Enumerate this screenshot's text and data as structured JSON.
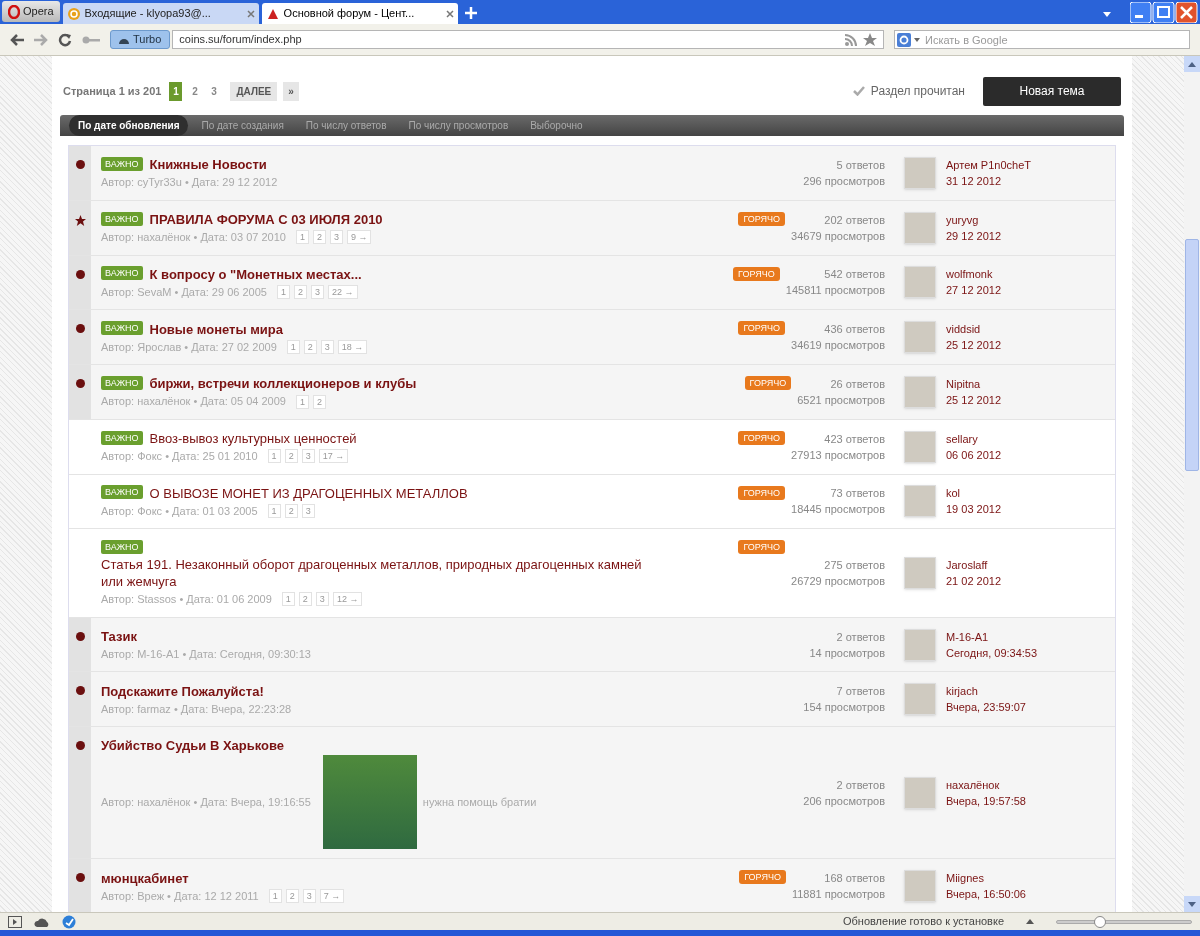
{
  "browser": {
    "menu_label": "Opera",
    "tabs": [
      {
        "title": "Входящие - klyopa93@...",
        "selected": false
      },
      {
        "title": "Основной форум - Цент...",
        "selected": true
      }
    ],
    "turbo": "Turbo",
    "address": "coins.su/forum/index.php",
    "search_placeholder": "Искать в Google"
  },
  "pagination": {
    "label": "Страница 1 из 201",
    "pages": [
      {
        "label": "1",
        "selected": true
      },
      {
        "label": "2",
        "selected": false
      },
      {
        "label": "3",
        "selected": false
      }
    ],
    "next": "ДАЛЕЕ",
    "last": "»"
  },
  "mark_read": "Раздел прочитан",
  "new_topic": "Новая тема",
  "sort_tabs": [
    {
      "label": "По дате обновления",
      "selected": true
    },
    {
      "label": "По дате создания",
      "selected": false
    },
    {
      "label": "По числу ответов",
      "selected": false
    },
    {
      "label": "По числу просмотров",
      "selected": false
    },
    {
      "label": "Выборочно",
      "selected": false
    }
  ],
  "topics": [
    {
      "unread": true,
      "starred": false,
      "badge": "ВАЖНО",
      "title": "Книжные Новости",
      "meta": "Автор: cyTyr33u • Дата: 29 12 2012",
      "replies": "5 ответов",
      "views": "296 просмотров",
      "last_user": "Артем P1n0cheT",
      "last_date": "31 12 2012"
    },
    {
      "unread": true,
      "starred": true,
      "badge": "ВАЖНО",
      "title": "ПРАВИЛА ФОРУМА С 03 ИЮЛЯ 2010",
      "meta": "Автор: нахалёнок • Дата: 03 07 2010",
      "pages": [
        "1",
        "2",
        "3",
        "9 →"
      ],
      "hot": "ГОРЯЧО",
      "replies": "202 ответов",
      "views": "34679 просмотров",
      "last_user": "yuryvg",
      "last_date": "29 12 2012"
    },
    {
      "unread": true,
      "starred": false,
      "badge": "ВАЖНО",
      "title": "К вопросу о \"Монетных местах...",
      "meta": "Автор: SevaM • Дата: 29 06 2005",
      "pages": [
        "1",
        "2",
        "3",
        "22 →"
      ],
      "hot": "ГОРЯЧО",
      "replies": "542 ответов",
      "views": "145811 просмотров",
      "last_user": "wolfmonk",
      "last_date": "27 12 2012"
    },
    {
      "unread": true,
      "starred": false,
      "badge": "ВАЖНО",
      "title": "Новые монеты мира",
      "meta": "Автор: Ярослав • Дата: 27 02 2009",
      "pages": [
        "1",
        "2",
        "3",
        "18 →"
      ],
      "hot": "ГОРЯЧО",
      "replies": "436 ответов",
      "views": "34619 просмотров",
      "last_user": "viddsid",
      "last_date": "25 12 2012"
    },
    {
      "unread": true,
      "starred": false,
      "badge": "ВАЖНО",
      "title": "биржи, встречи коллекционеров и клубы",
      "meta": "Автор: нахалёнок • Дата: 05 04 2009",
      "pages": [
        "1",
        "2"
      ],
      "hot": "ГОРЯЧО",
      "replies": "26 ответов",
      "views": "6521 просмотров",
      "last_user": "Nipitna",
      "last_date": "25 12 2012"
    },
    {
      "unread": false,
      "starred": false,
      "badge": "ВАЖНО",
      "title": "Ввоз-вывоз культурных ценностей",
      "meta": "Автор: Фокс • Дата: 25 01 2010",
      "pages": [
        "1",
        "2",
        "3",
        "17 →"
      ],
      "hot": "ГОРЯЧО",
      "replies": "423 ответов",
      "views": "27913 просмотров",
      "last_user": "sellary",
      "last_date": "06 06 2012"
    },
    {
      "unread": false,
      "starred": false,
      "badge": "ВАЖНО",
      "title": "О ВЫВОЗЕ МОНЕТ ИЗ ДРАГОЦЕННЫХ МЕТАЛЛОВ",
      "meta": "Автор: Фокс • Дата: 01 03 2005",
      "pages": [
        "1",
        "2",
        "3"
      ],
      "hot": "ГОРЯЧО",
      "replies": "73 ответов",
      "views": "18445 просмотров",
      "last_user": "kol",
      "last_date": "19 03 2012"
    },
    {
      "unread": false,
      "starred": false,
      "badge": "ВАЖНО",
      "title": "Статья 191. Незаконный оборот драгоценных металлов, природных драгоценных камней или жемчуга",
      "meta": "Автор: Stassos • Дата: 01 06 2009",
      "pages": [
        "1",
        "2",
        "3",
        "12 →"
      ],
      "hot": "ГОРЯЧО",
      "replies": "275 ответов",
      "views": "26729 просмотров",
      "last_user": "Jaroslaff",
      "last_date": "21 02 2012"
    },
    {
      "unread": true,
      "starred": false,
      "title": "Тазик",
      "meta": "Автор: M-16-A1 • Дата: Сегодня, 09:30:13",
      "replies": "2 ответов",
      "views": "14 просмотров",
      "last_user": "M-16-A1",
      "last_date": "Сегодня, 09:34:53"
    },
    {
      "unread": true,
      "starred": false,
      "title": "Подскажите Пожалуйста!",
      "meta": "Автор: farmaz • Дата: Вчера, 22:23:28",
      "replies": "7 ответов",
      "views": "154 просмотров",
      "last_user": "kirjach",
      "last_date": "Вчера, 23:59:07"
    },
    {
      "unread": true,
      "starred": false,
      "title": "Убийство Судьи В Харькове",
      "meta": "Автор: нахалёнок • Дата: Вчера, 19:16:55",
      "photo": true,
      "note": "нужна помощь братии",
      "replies": "2 ответов",
      "views": "206 просмотров",
      "last_user": "нахалёнок",
      "last_date": "Вчера, 19:57:58"
    },
    {
      "unread": true,
      "starred": false,
      "title": "мюнцкабинет",
      "meta": "Автор: Вреж • Дата: 12 12 2011",
      "pages": [
        "1",
        "2",
        "3",
        "7 →"
      ],
      "hot": "ГОРЯЧО",
      "replies": "168 ответов",
      "views": "11881 просмотров",
      "last_user": "Miignes",
      "last_date": "Вчера, 16:50:06"
    }
  ],
  "status_bar": {
    "message": "Обновление готово к установке",
    "zoom": {
      "level": 0.32
    }
  }
}
